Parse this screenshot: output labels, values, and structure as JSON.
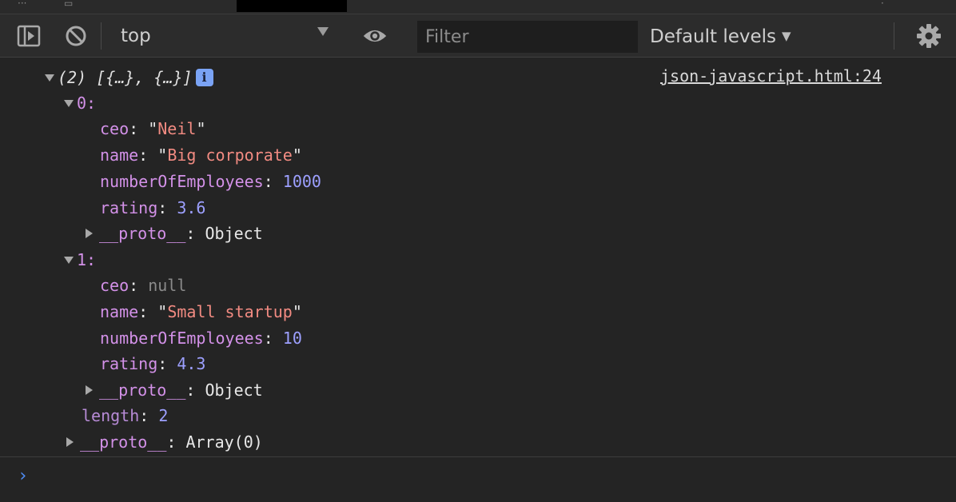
{
  "toolbar": {
    "context": "top",
    "filter_placeholder": "Filter",
    "levels": "Default levels"
  },
  "log": {
    "summary": "(2) [{…}, {…}]",
    "info_badge": "i",
    "source": "json-javascript.html:24",
    "items": [
      {
        "index": "0:",
        "ceo_key": "ceo",
        "ceo_value": "Neil",
        "name_key": "name",
        "name_value": "Big corporate",
        "employees_key": "numberOfEmployees",
        "employees_value": "1000",
        "rating_key": "rating",
        "rating_value": "3.6",
        "proto_key": "__proto__",
        "proto_value": "Object"
      },
      {
        "index": "1:",
        "ceo_key": "ceo",
        "ceo_value": "null",
        "name_key": "name",
        "name_value": "Small startup",
        "employees_key": "numberOfEmployees",
        "employees_value": "10",
        "rating_key": "rating",
        "rating_value": "4.3",
        "proto_key": "__proto__",
        "proto_value": "Object"
      }
    ],
    "length_key": "length",
    "length_value": "2",
    "array_proto_key": "__proto__",
    "array_proto_value": "Array(0)"
  },
  "prompt_symbol": "›",
  "colors": {
    "background": "#242424",
    "key": "#d391e8",
    "string": "#f28b82",
    "number": "#9da0ff",
    "null": "#8a8a8a",
    "prompt": "#4f8df6"
  }
}
